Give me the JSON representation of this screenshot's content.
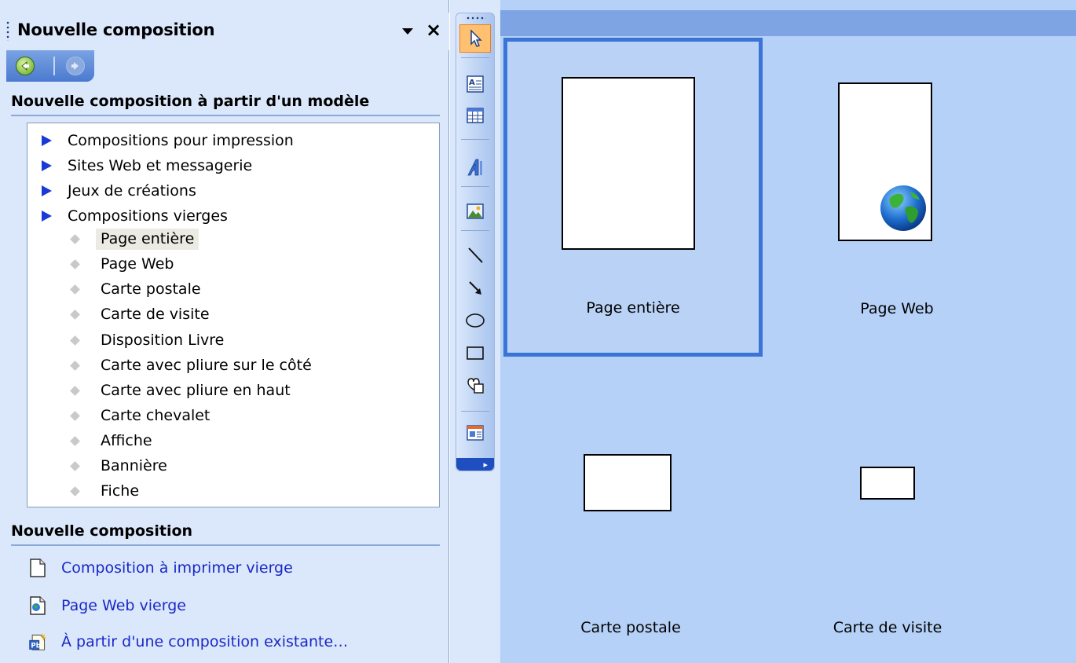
{
  "task_pane": {
    "title": "Nouvelle composition",
    "close_glyph": "×",
    "nav": {
      "back_icon": "back-arrow-icon",
      "forward_icon": "forward-arrow-icon"
    },
    "section_templates": {
      "heading": "Nouvelle composition à partir d'un modèle",
      "categories": [
        "Compositions pour impression",
        "Sites Web et messagerie",
        "Jeux de créations",
        "Compositions vierges"
      ],
      "blank_items": [
        "Page entière",
        "Page Web",
        "Carte postale",
        "Carte de visite",
        "Disposition Livre",
        "Carte avec pliure sur le côté",
        "Carte avec pliure en haut",
        "Carte chevalet",
        "Affiche",
        "Bannière",
        "Fiche"
      ],
      "selected_item": "Page entière"
    },
    "section_new": {
      "heading": "Nouvelle composition",
      "links": [
        {
          "label": "Composition à imprimer vierge",
          "icon": "blank-document-icon"
        },
        {
          "label": "Page Web vierge",
          "icon": "web-page-icon"
        },
        {
          "label": "À partir d'une composition existante…",
          "icon": "publisher-file-icon"
        }
      ]
    }
  },
  "toolbar": {
    "tools": [
      "pointer-tool-icon",
      "text-box-tool-icon",
      "table-tool-icon",
      "wordart-tool-icon",
      "picture-tool-icon",
      "line-tool-icon",
      "arrow-tool-icon",
      "oval-tool-icon",
      "rectangle-tool-icon",
      "autoshapes-tool-icon",
      "design-gallery-object-icon"
    ],
    "active_tool": "pointer-tool-icon"
  },
  "gallery": {
    "items": [
      {
        "label": "Page entière",
        "selected": true
      },
      {
        "label": "Page Web",
        "selected": false
      },
      {
        "label": "Carte postale",
        "selected": false
      },
      {
        "label": "Carte de visite",
        "selected": false
      }
    ]
  },
  "colors": {
    "pane_bg": "#dbe8fb",
    "gallery_bg": "#b5d1f7",
    "selection_border": "#3a74d6",
    "link_color": "#1a28c8",
    "bullet_arrow": "#1a3ad8"
  }
}
